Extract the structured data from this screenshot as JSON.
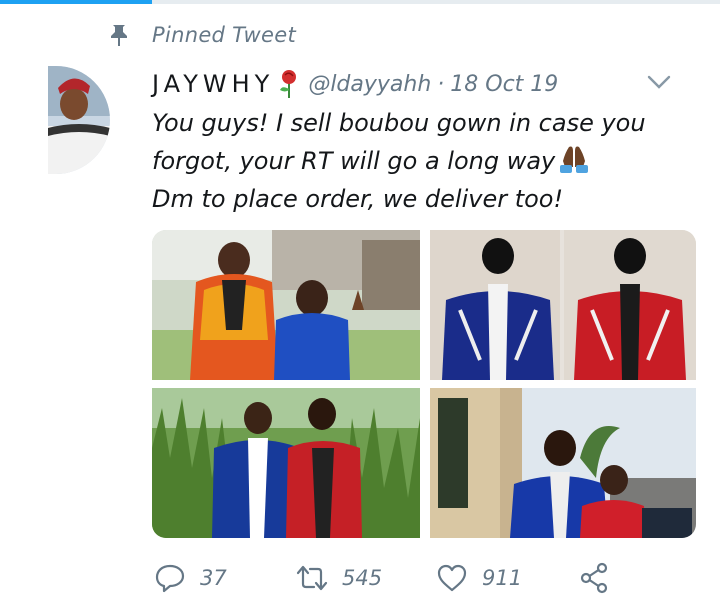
{
  "pinned": {
    "label": "Pinned Tweet"
  },
  "tweet": {
    "display_name": "JAYWHY",
    "handle": "@ldayyahh",
    "separator": "·",
    "date": "18 Oct 19",
    "text_lines": [
      "You guys! I sell boubou gown in case you",
      "forgot, your RT will go a long way",
      "Dm to place order, we deliver too!"
    ],
    "emoji": [
      "rose",
      "folded-hands"
    ]
  },
  "actions": {
    "replies": "37",
    "retweets": "545",
    "likes": "911"
  },
  "colors": {
    "accent": "#1da1f2",
    "secondary_text": "#657786",
    "primary_text": "#14171a"
  },
  "icons": [
    "pin-icon",
    "chevron-down-icon",
    "reply-icon",
    "retweet-icon",
    "like-icon",
    "share-icon"
  ]
}
